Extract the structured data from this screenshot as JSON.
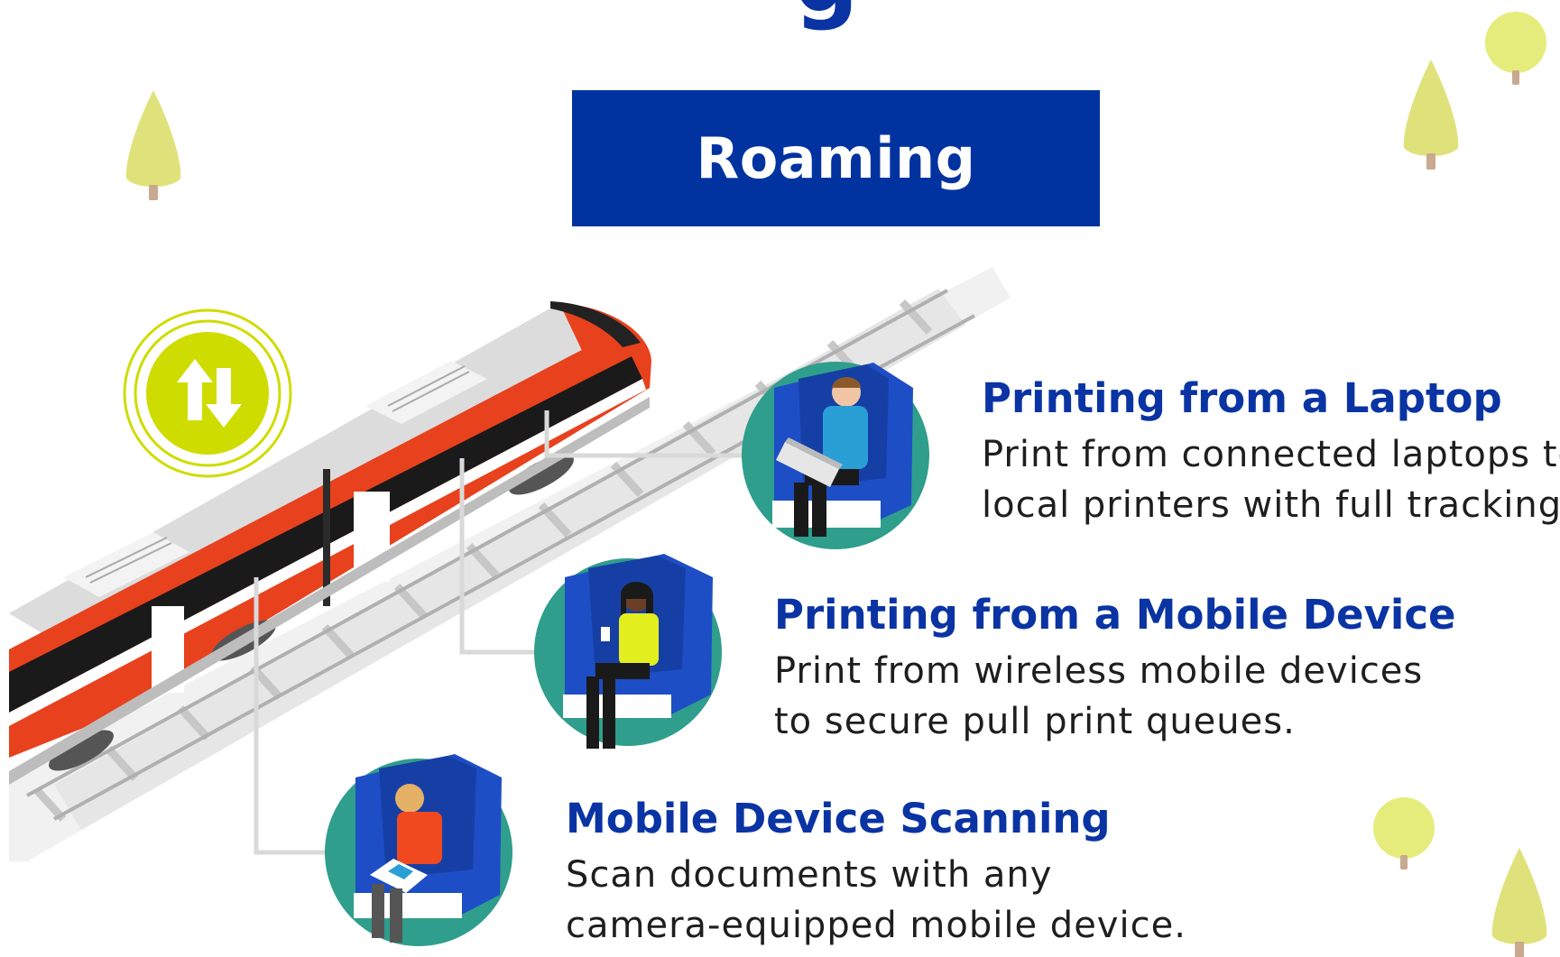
{
  "heading": {
    "partial_text": "g"
  },
  "banner": {
    "label": "Roaming"
  },
  "features": [
    {
      "title": "Printing from a Laptop",
      "description_lines": [
        "Print from connected laptops to",
        "local printers with full tracking."
      ]
    },
    {
      "title": "Printing from a Mobile Device",
      "description_lines": [
        "Print from wireless mobile devices",
        "to secure pull print queues."
      ]
    },
    {
      "title": "Mobile Device Scanning",
      "description_lines": [
        "Scan documents with any",
        "camera-equipped mobile device."
      ]
    }
  ],
  "icons": {
    "sync": "up-down-arrows-icon",
    "laptop_person": "person-with-laptop-icon",
    "phone_person": "person-with-phone-icon",
    "tablet_person": "person-with-tablet-icon",
    "train": "train-illustration",
    "tree": "tree-icon"
  },
  "colors": {
    "brand_blue": "#0033a0",
    "title_blue": "#0a34a3",
    "train_red": "#e8411d",
    "accent_lime": "#cfdc00",
    "circle_teal": "#2f9e8c",
    "tree_yellow": "#dfe27a"
  }
}
